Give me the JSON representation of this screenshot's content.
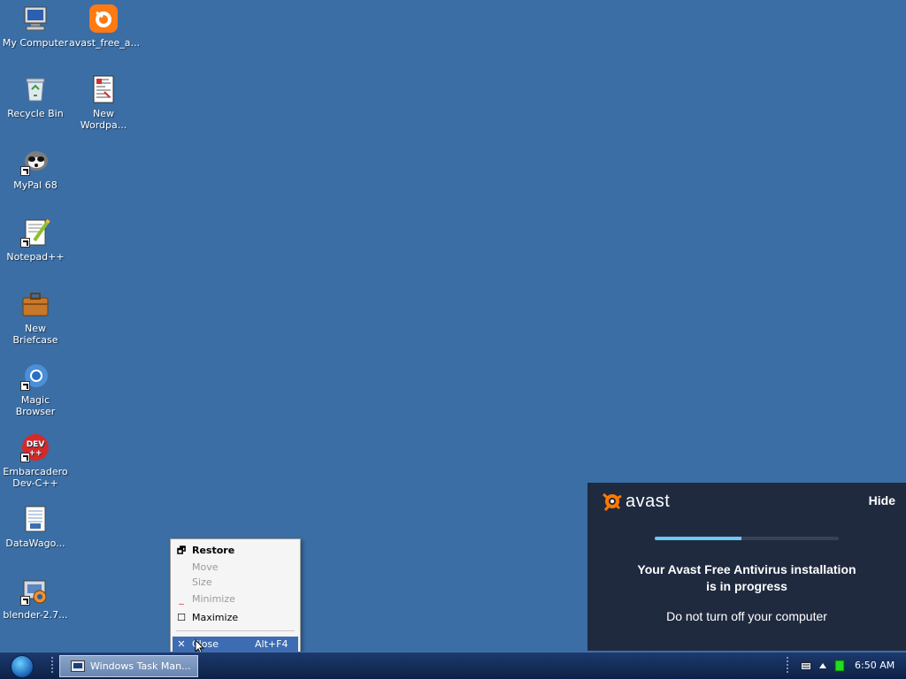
{
  "desktop": {
    "icons": [
      {
        "label": "My Computer",
        "icon": "computer-icon"
      },
      {
        "label": "avast_free_a...",
        "icon": "avast-installer-icon"
      },
      {
        "label": "Recycle Bin",
        "icon": "recycle-bin-icon"
      },
      {
        "label": "New Wordpa...",
        "icon": "wordpad-document-icon"
      },
      {
        "label": "MyPal 68",
        "icon": "mypal-icon"
      },
      {
        "label": "Notepad++",
        "icon": "notepadpp-icon"
      },
      {
        "label": "New Briefcase",
        "icon": "briefcase-icon"
      },
      {
        "label": "Magic Browser",
        "icon": "magic-browser-icon"
      },
      {
        "label": "Embarcadero Dev-C++",
        "icon": "devcpp-icon"
      },
      {
        "label": "DataWago...",
        "icon": "datawagon-icon"
      },
      {
        "label": "blender-2.7...",
        "icon": "blender-installer-icon"
      }
    ]
  },
  "context_menu": {
    "items": [
      {
        "label": "Restore",
        "shortcut": "",
        "state": "default",
        "mark": "restore-icon"
      },
      {
        "label": "Move",
        "shortcut": "",
        "state": "disabled",
        "mark": ""
      },
      {
        "label": "Size",
        "shortcut": "",
        "state": "disabled",
        "mark": ""
      },
      {
        "label": "Minimize",
        "shortcut": "",
        "state": "disabled",
        "mark": "minimize-icon"
      },
      {
        "label": "Maximize",
        "shortcut": "",
        "state": "enabled",
        "mark": "maximize-icon"
      },
      {
        "label": "Close",
        "shortcut": "Alt+F4",
        "state": "selected",
        "mark": "close-icon"
      }
    ]
  },
  "avast_panel": {
    "brand": "avast",
    "hide_label": "Hide",
    "progress_fraction": 0.47,
    "title_line1": "Your Avast Free Antivirus installation",
    "title_line2": "is in progress",
    "subtitle": "Do not turn off your computer",
    "colors": {
      "background": "#1f2a3f",
      "accent": "#ff7800",
      "progress": "#6ec6f2"
    }
  },
  "taskbar": {
    "task_button_label": "Windows Task Man...",
    "clock": "6:50 AM"
  },
  "colors": {
    "desktop_background": "#3a6ea5",
    "menu_highlight": "#3d6cb3"
  }
}
